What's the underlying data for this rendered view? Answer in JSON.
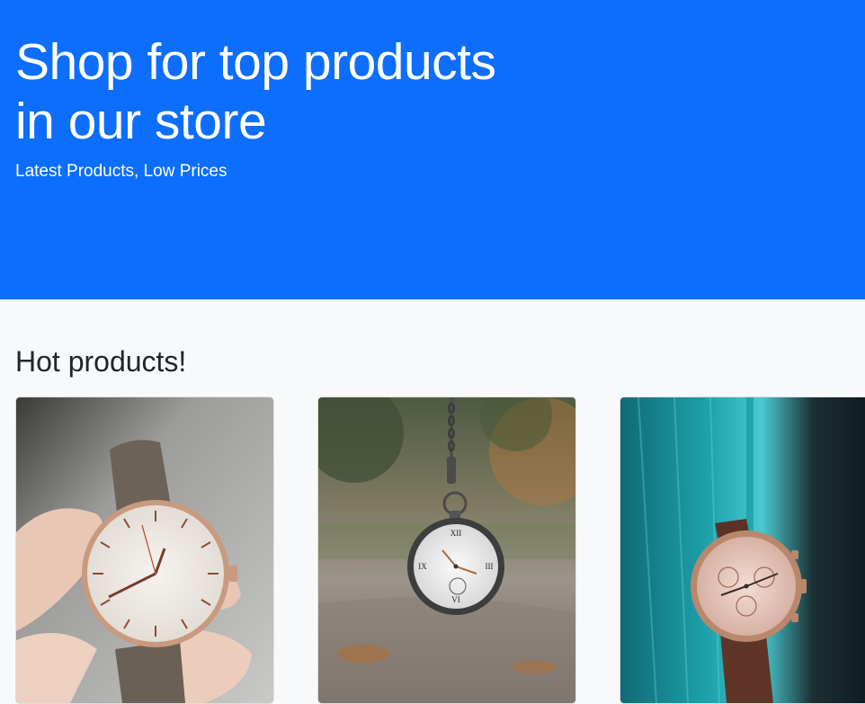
{
  "hero": {
    "title_line1": "Shop for top products",
    "title_line2": "in our store",
    "subtitle": "Latest Products, Low Prices",
    "background_color": "#0d6efd"
  },
  "products_section": {
    "title": "Hot products!",
    "cards": [
      {
        "image": "wristwatch-in-hand"
      },
      {
        "image": "pocket-watch-on-chain"
      },
      {
        "image": "chronograph-watch-on-teal-fabric"
      }
    ]
  }
}
